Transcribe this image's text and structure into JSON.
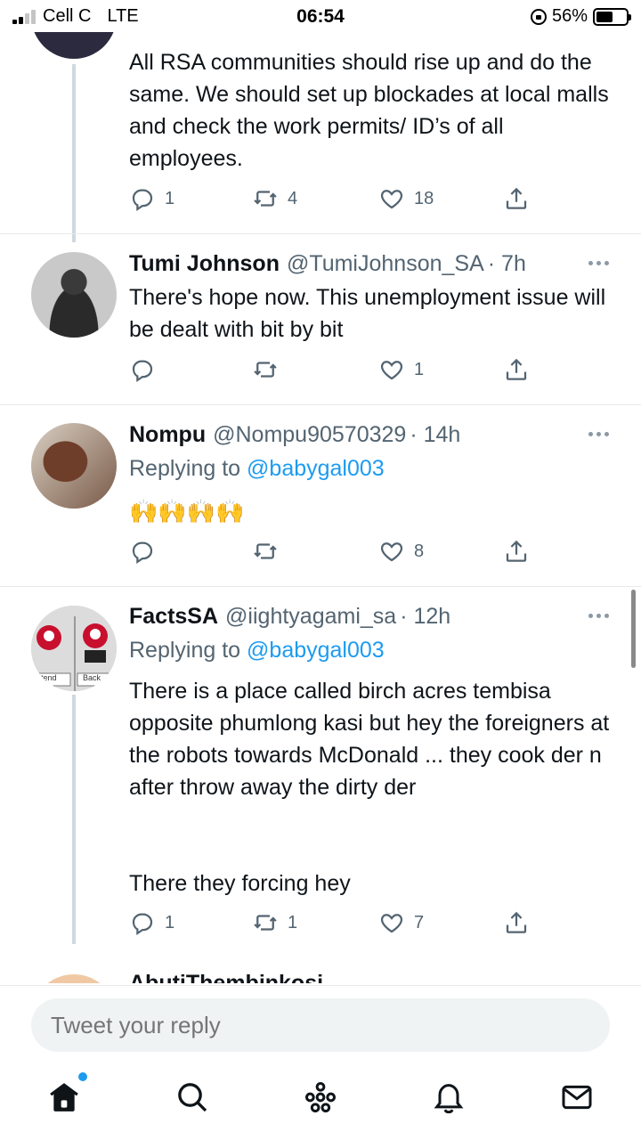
{
  "status_bar": {
    "carrier": "Cell C",
    "network": "LTE",
    "time": "06:54",
    "battery": "56%",
    "battery_level": 0.56
  },
  "partial_top": {
    "body": "All RSA communities should rise up and do the same. We should set up blockades at local malls and check the work permits/ ID’s of all employees.",
    "actions": {
      "replies": "1",
      "retweets": "4",
      "likes": "18"
    }
  },
  "tweets": [
    {
      "name": "Tumi Johnson",
      "handle": "@TumiJohnson_SA",
      "time": "· 7h",
      "body": "There's hope  now. This unemployment issue will be dealt with bit by bit",
      "actions": {
        "replies": "",
        "retweets": "",
        "likes": "1"
      }
    },
    {
      "name": "Nompu",
      "handle": "@Nompu90570329",
      "time": "· 14h",
      "replying_prefix": "Replying to",
      "replying_to": "@babygal003",
      "body": "🙌🙌🙌🙌",
      "actions": {
        "replies": "",
        "retweets": "",
        "likes": "8"
      }
    },
    {
      "name": "FactsSA",
      "handle": "@iightyagami_sa",
      "time": "· 12h",
      "replying_prefix": "Replying to",
      "replying_to": "@babygal003",
      "body_1": "There is  a place called birch acres tembisa opposite phumlong kasi  but hey the foreigners at the robots towards McDonald ... they cook der n after throw away the dirty der",
      "body_2": "There they forcing hey",
      "avatar_labels": {
        "left": "ntend",
        "right": "Back"
      },
      "actions": {
        "replies": "1",
        "retweets": "1",
        "likes": "7"
      }
    }
  ],
  "partial_bottom": {
    "name_fragment": "AbutiThembinkosi"
  },
  "reply": {
    "placeholder": "Tweet your reply"
  },
  "colors": {
    "accent": "#1d9bf0",
    "text": "#0f1419",
    "secondary": "#536471",
    "line": "#cfd9de"
  },
  "icons": [
    "reply-icon",
    "retweet-icon",
    "like-icon",
    "share-icon",
    "home-icon",
    "search-icon",
    "spaces-icon",
    "notifications-icon",
    "messages-icon"
  ]
}
